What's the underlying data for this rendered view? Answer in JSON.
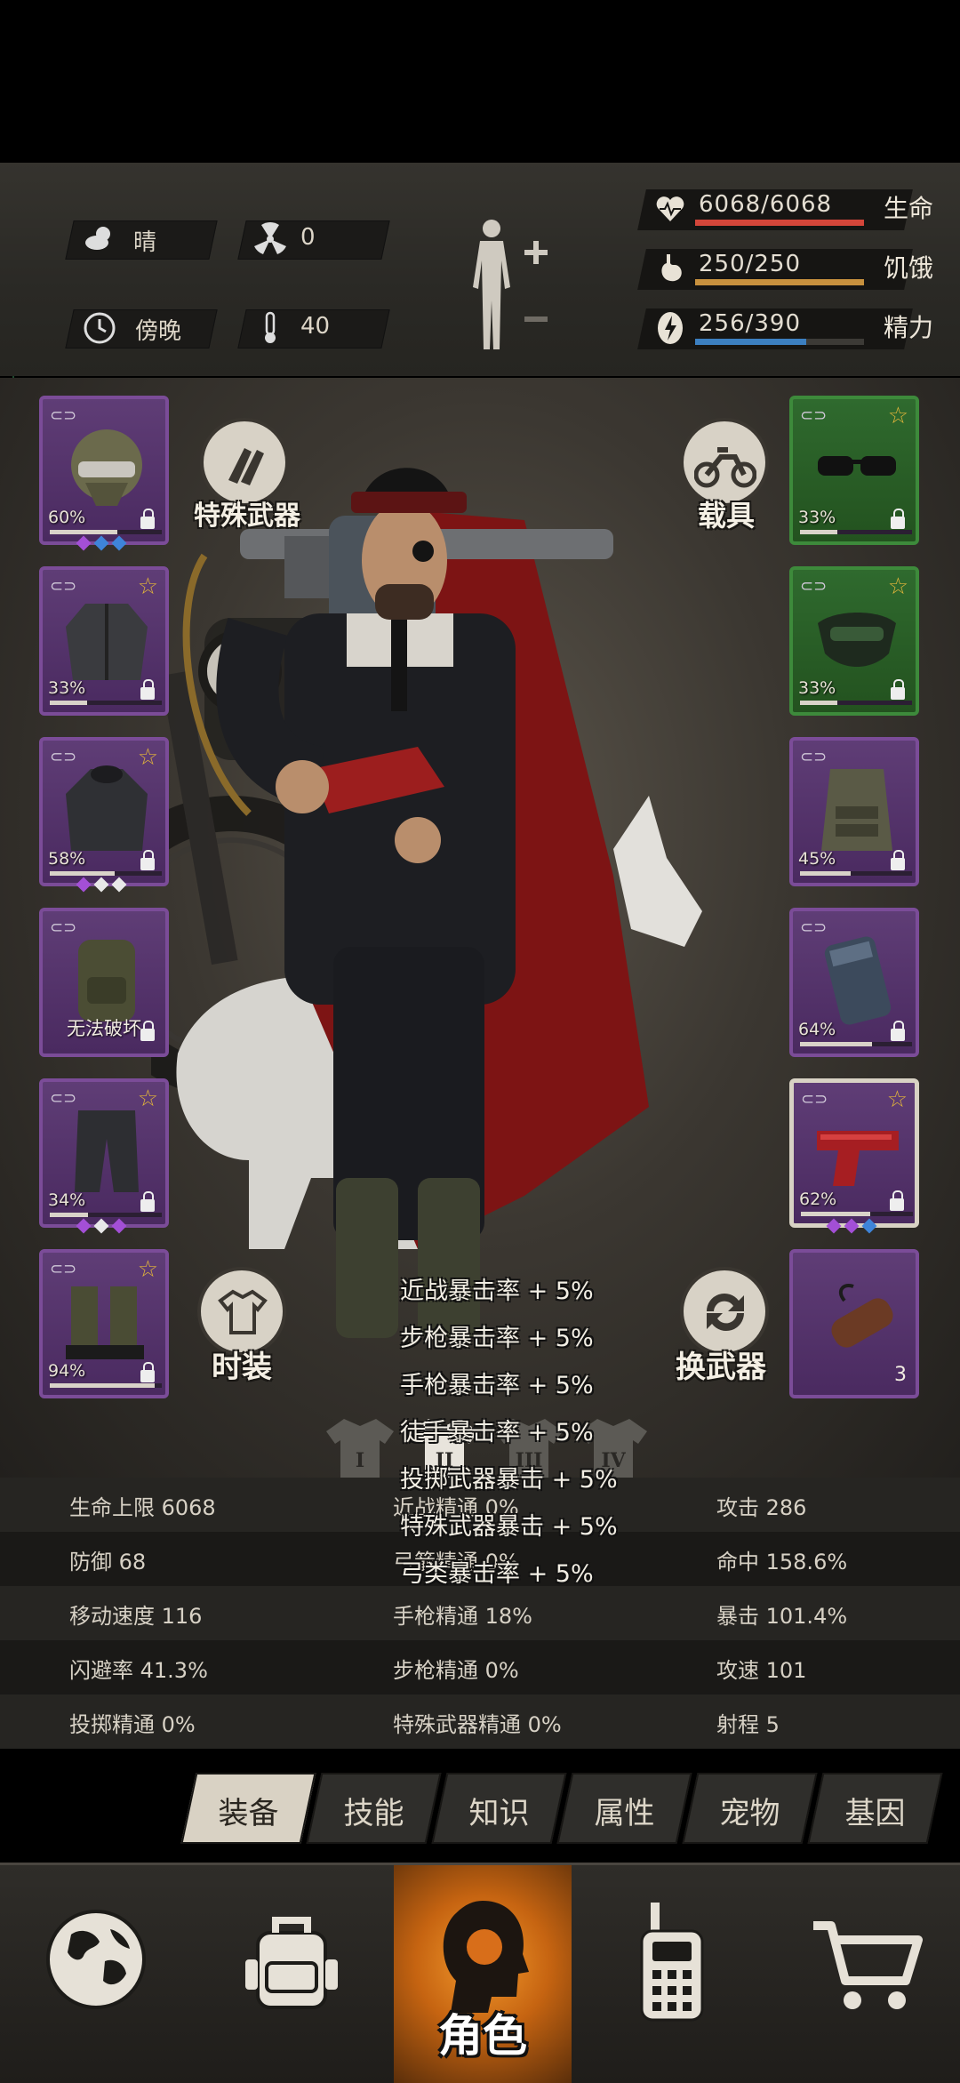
{
  "environment": {
    "weather": "晴",
    "radiation": "0",
    "time_of_day": "傍晚",
    "temperature": "40"
  },
  "vitals": [
    {
      "key": "hp",
      "label": "生命",
      "value": "6068/6068",
      "fraction": 1.0,
      "color": "#d4463a",
      "icon": "heart-icon"
    },
    {
      "key": "hunger",
      "label": "饥饿",
      "value": "250/250",
      "fraction": 1.0,
      "color": "#c8913e",
      "icon": "stomach-icon"
    },
    {
      "key": "energy",
      "label": "精力",
      "value": "256/390",
      "fraction": 0.656,
      "color": "#3c7fc0",
      "icon": "energy-icon"
    }
  ],
  "scene": {
    "special_weapon_label": "特殊武器",
    "vehicle_label": "载具",
    "costume_label": "时装",
    "switch_weapon_label": "换武器",
    "costume_slots": [
      "I",
      "II",
      "III",
      "IV"
    ]
  },
  "left_slots": [
    {
      "name": "helmet",
      "pct": "60%",
      "durability": 0.6,
      "star": false,
      "gems": [
        "#a34fd6",
        "#3e84d9",
        "#3e84d9"
      ]
    },
    {
      "name": "jacket",
      "pct": "33%",
      "durability": 0.33,
      "star": true,
      "gems": []
    },
    {
      "name": "coat",
      "pct": "58%",
      "durability": 0.58,
      "star": true,
      "gems": [
        "#a34fd6",
        "#e8e8e8",
        "#e8e8e8"
      ]
    },
    {
      "name": "backpack",
      "pct": "",
      "durability": 1.0,
      "star": false,
      "unbreakable": "无法破坏",
      "gems": []
    },
    {
      "name": "pants",
      "pct": "34%",
      "durability": 0.34,
      "star": true,
      "gems": [
        "#a34fd6",
        "#e8e8e8",
        "#a34fd6"
      ]
    },
    {
      "name": "boots",
      "pct": "94%",
      "durability": 0.94,
      "star": true,
      "gems": []
    }
  ],
  "right_slots": [
    {
      "name": "glasses",
      "pct": "33%",
      "durability": 0.33,
      "star": true,
      "green": true,
      "gems": []
    },
    {
      "name": "mask",
      "pct": "33%",
      "durability": 0.33,
      "star": true,
      "green": true,
      "gems": []
    },
    {
      "name": "vest",
      "pct": "45%",
      "durability": 0.45,
      "star": false,
      "gems": []
    },
    {
      "name": "shield",
      "pct": "64%",
      "durability": 0.64,
      "star": false,
      "gems": []
    },
    {
      "name": "pistol",
      "pct": "62%",
      "durability": 0.62,
      "star": true,
      "selected": true,
      "gems": [
        "#a34fd6",
        "#a34fd6",
        "#3e84d9"
      ]
    },
    {
      "name": "dynamite",
      "pct": "",
      "durability": 0,
      "star": false,
      "count": "3",
      "gems": []
    }
  ],
  "buffs": [
    "近战暴击率 + 5%",
    "步枪暴击率 + 5%",
    "手枪暴击率 + 5%",
    "徒手暴击率 + 5%",
    "投掷武器暴击 + 5%",
    "特殊武器暴击 + 5%",
    "弓类暴击率 + 5%"
  ],
  "attributes": [
    [
      "生命上限 6068",
      "近战精通 0%",
      "攻击 286"
    ],
    [
      "防御 68",
      "弓箭精通 0%",
      "命中 158.6%"
    ],
    [
      "移动速度 116",
      "手枪精通 18%",
      "暴击 101.4%"
    ],
    [
      "闪避率 41.3%",
      "步枪精通 0%",
      "攻速 101"
    ],
    [
      "投掷精通 0%",
      "特殊武器精通 0%",
      "射程 5"
    ]
  ],
  "tabs": [
    {
      "label": "装备",
      "active": true
    },
    {
      "label": "技能",
      "active": false
    },
    {
      "label": "知识",
      "active": false
    },
    {
      "label": "属性",
      "active": false
    },
    {
      "label": "宠物",
      "active": false
    },
    {
      "label": "基因",
      "active": false
    }
  ],
  "bottom_nav": [
    {
      "key": "map",
      "icon": "globe-icon"
    },
    {
      "key": "bag",
      "icon": "backpack-icon"
    },
    {
      "key": "character",
      "label": "角色",
      "active": true
    },
    {
      "key": "radio",
      "icon": "walkie-talkie-icon"
    },
    {
      "key": "shop",
      "icon": "cart-icon"
    }
  ]
}
